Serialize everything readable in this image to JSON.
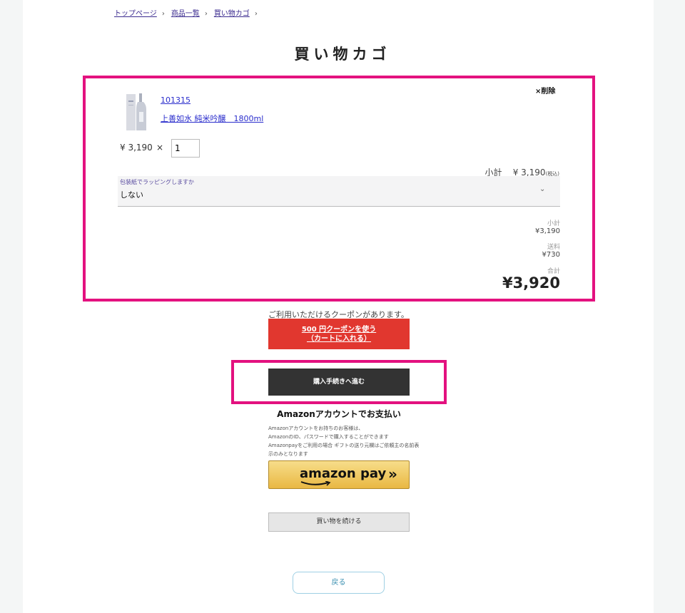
{
  "breadcrumb": [
    "トップページ",
    "商品一覧",
    "買い物カゴ"
  ],
  "page_title": "買い物カゴ",
  "cart": {
    "delete_label": "×削除",
    "item": {
      "code": "101315",
      "name": "上善如水 純米吟醸　1800ml",
      "unit_price": "¥ 3,190",
      "times": "×",
      "quantity": "1",
      "subtotal_label": "小計",
      "subtotal_value": "¥ 3,190",
      "tax_note": "(税込)"
    },
    "wrapping": {
      "label": "包装紙でラッピングしますか",
      "value": "しない"
    },
    "totals": {
      "subtotal_label": "小計",
      "subtotal_value": "¥3,190",
      "shipping_label": "送料",
      "shipping_value": "¥730",
      "total_label": "合計",
      "total_value": "¥3,920"
    }
  },
  "coupon": {
    "notice": "ご利用いただけるクーポンがあります。",
    "button_line1": "500 円クーポンを使う",
    "button_line2": "（カートに入れる）"
  },
  "proceed_label": "購入手続きへ進む",
  "amazon": {
    "title": "Amazonアカウントでお支払い",
    "notes": [
      "Amazonアカウントをお持ちのお客様は、",
      "AmazonのID、パスワードで購入することができます",
      "Amazonpayをご利用の場合 ギフトの送り元欄はご依頼主の名前表",
      "示のみとなります"
    ],
    "button_text": "amazon pay",
    "button_chevron": "»"
  },
  "continue_label": "買い物を続ける",
  "back_label": "戻る",
  "colors": {
    "highlight": "#e3117f",
    "coupon": "#e1372f",
    "proceed": "#333333"
  }
}
